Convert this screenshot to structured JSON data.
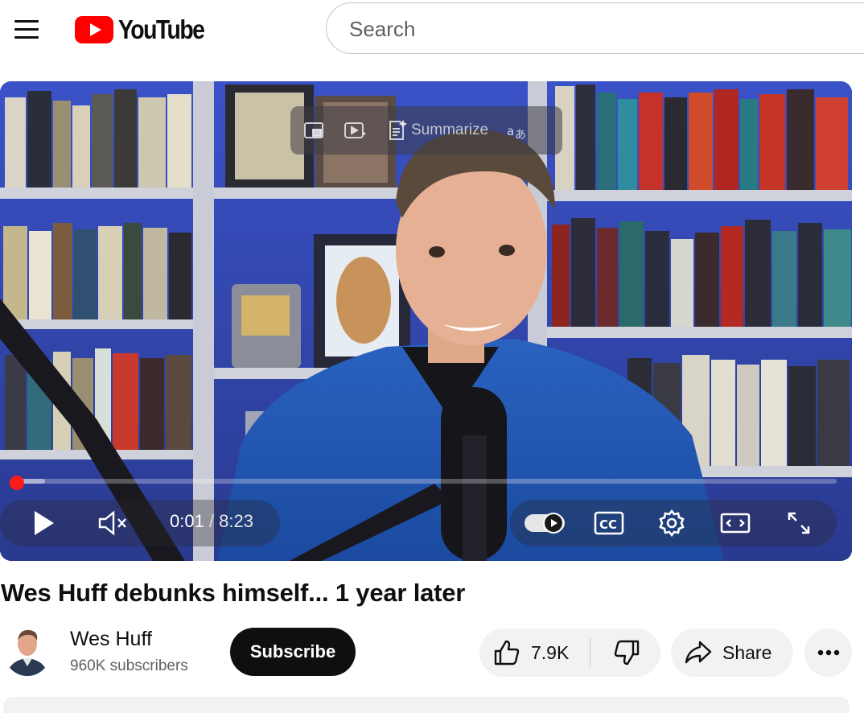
{
  "header": {
    "logo_text": "YouTube",
    "search_placeholder": "Search"
  },
  "player": {
    "overlay": {
      "summarize_label": "Summarize"
    },
    "current_time": "0:01",
    "time_separator": " / ",
    "duration": "8:23",
    "progress_fraction": 0.002,
    "autoplay_on": true
  },
  "video": {
    "title": "Wes Huff debunks himself... 1 year later"
  },
  "channel": {
    "name": "Wes Huff",
    "subscribers": "960K subscribers",
    "subscribe_label": "Subscribe"
  },
  "actions": {
    "like_count": "7.9K",
    "share_label": "Share"
  },
  "colors": {
    "brand_red": "#ff0000",
    "subscribe_bg": "#0f0f0f",
    "chip_bg": "#f2f2f2"
  }
}
